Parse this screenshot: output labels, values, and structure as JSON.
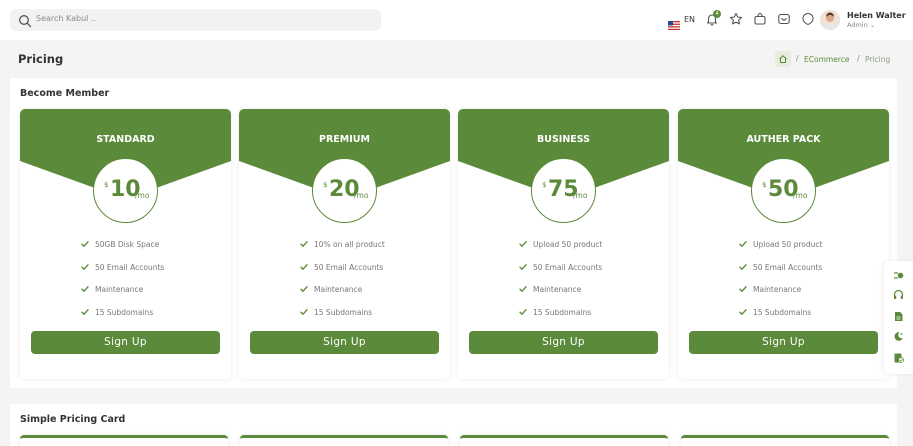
{
  "header": {
    "search_placeholder": "Search Kabul ..",
    "language": "EN",
    "notification_count": "4",
    "user_name": "Helen Walter",
    "user_role": "Admin"
  },
  "page": {
    "title": "Pricing",
    "breadcrumb": [
      "ECommerce",
      "Pricing"
    ]
  },
  "section1": {
    "title": "Become Member",
    "cards": [
      {
        "name": "STANDARD",
        "currency": "$",
        "price": "10",
        "period": "/mo",
        "features": [
          "50GB Disk Space",
          "50 Email Accounts",
          "Maintenance",
          "15 Subdomains"
        ],
        "button": "Sign Up"
      },
      {
        "name": "PREMIUM",
        "currency": "$",
        "price": "20",
        "period": "/mo",
        "features": [
          "10% on all product",
          "50 Email Accounts",
          "Maintenance",
          "15 Subdomains"
        ],
        "button": "Sign Up"
      },
      {
        "name": "BUSINESS",
        "currency": "$",
        "price": "75",
        "period": "/mo",
        "features": [
          "Upload 50 product",
          "50 Email Accounts",
          "Maintenance",
          "15 Subdomains"
        ],
        "button": "Sign Up"
      },
      {
        "name": "AUTHER PACK",
        "currency": "$",
        "price": "50",
        "period": "/mo",
        "features": [
          "Upload 50 product",
          "50 Email Accounts",
          "Maintenance",
          "15 Subdomains"
        ],
        "button": "Sign Up"
      }
    ]
  },
  "section2": {
    "title": "Simple Pricing Card"
  },
  "colors": {
    "accent": "#5b8a3a",
    "background": "#f4f4f4"
  },
  "icons": {
    "search": "search-icon",
    "notification": "bell-icon",
    "star": "star-icon",
    "bag": "shopping-bag-icon",
    "message": "message-icon",
    "theme": "moon-icon",
    "home": "home-icon",
    "check": "check-icon",
    "tools": [
      "settings-toggle-icon",
      "headphones-icon",
      "document-icon",
      "moon-star-icon",
      "clipboard-check-icon"
    ]
  }
}
